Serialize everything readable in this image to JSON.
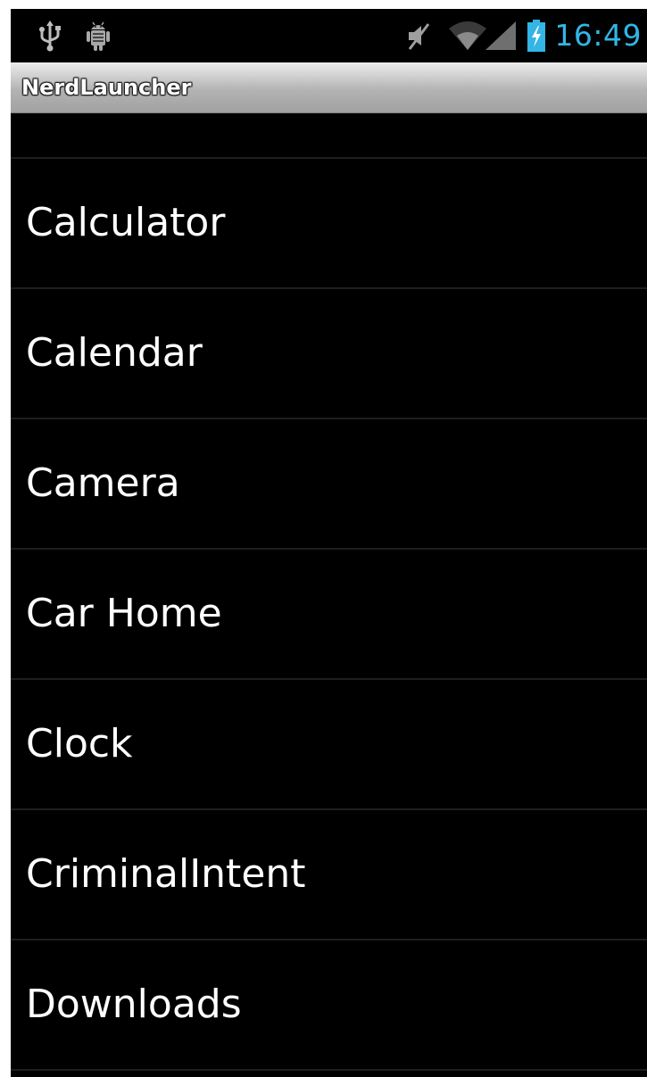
{
  "status_bar": {
    "time": "16:49",
    "time_color": "#33b5e5",
    "icons_left": [
      "usb-icon",
      "android-debug-icon"
    ],
    "icons_right": [
      "mute-icon",
      "wifi-icon",
      "signal-icon",
      "battery-charging-icon"
    ]
  },
  "title_bar": {
    "title": "NerdLauncher"
  },
  "app_list": {
    "items": [
      {
        "label": "Calculator"
      },
      {
        "label": "Calendar"
      },
      {
        "label": "Camera"
      },
      {
        "label": "Car Home"
      },
      {
        "label": "Clock"
      },
      {
        "label": "CriminalIntent"
      },
      {
        "label": "Downloads"
      }
    ]
  }
}
